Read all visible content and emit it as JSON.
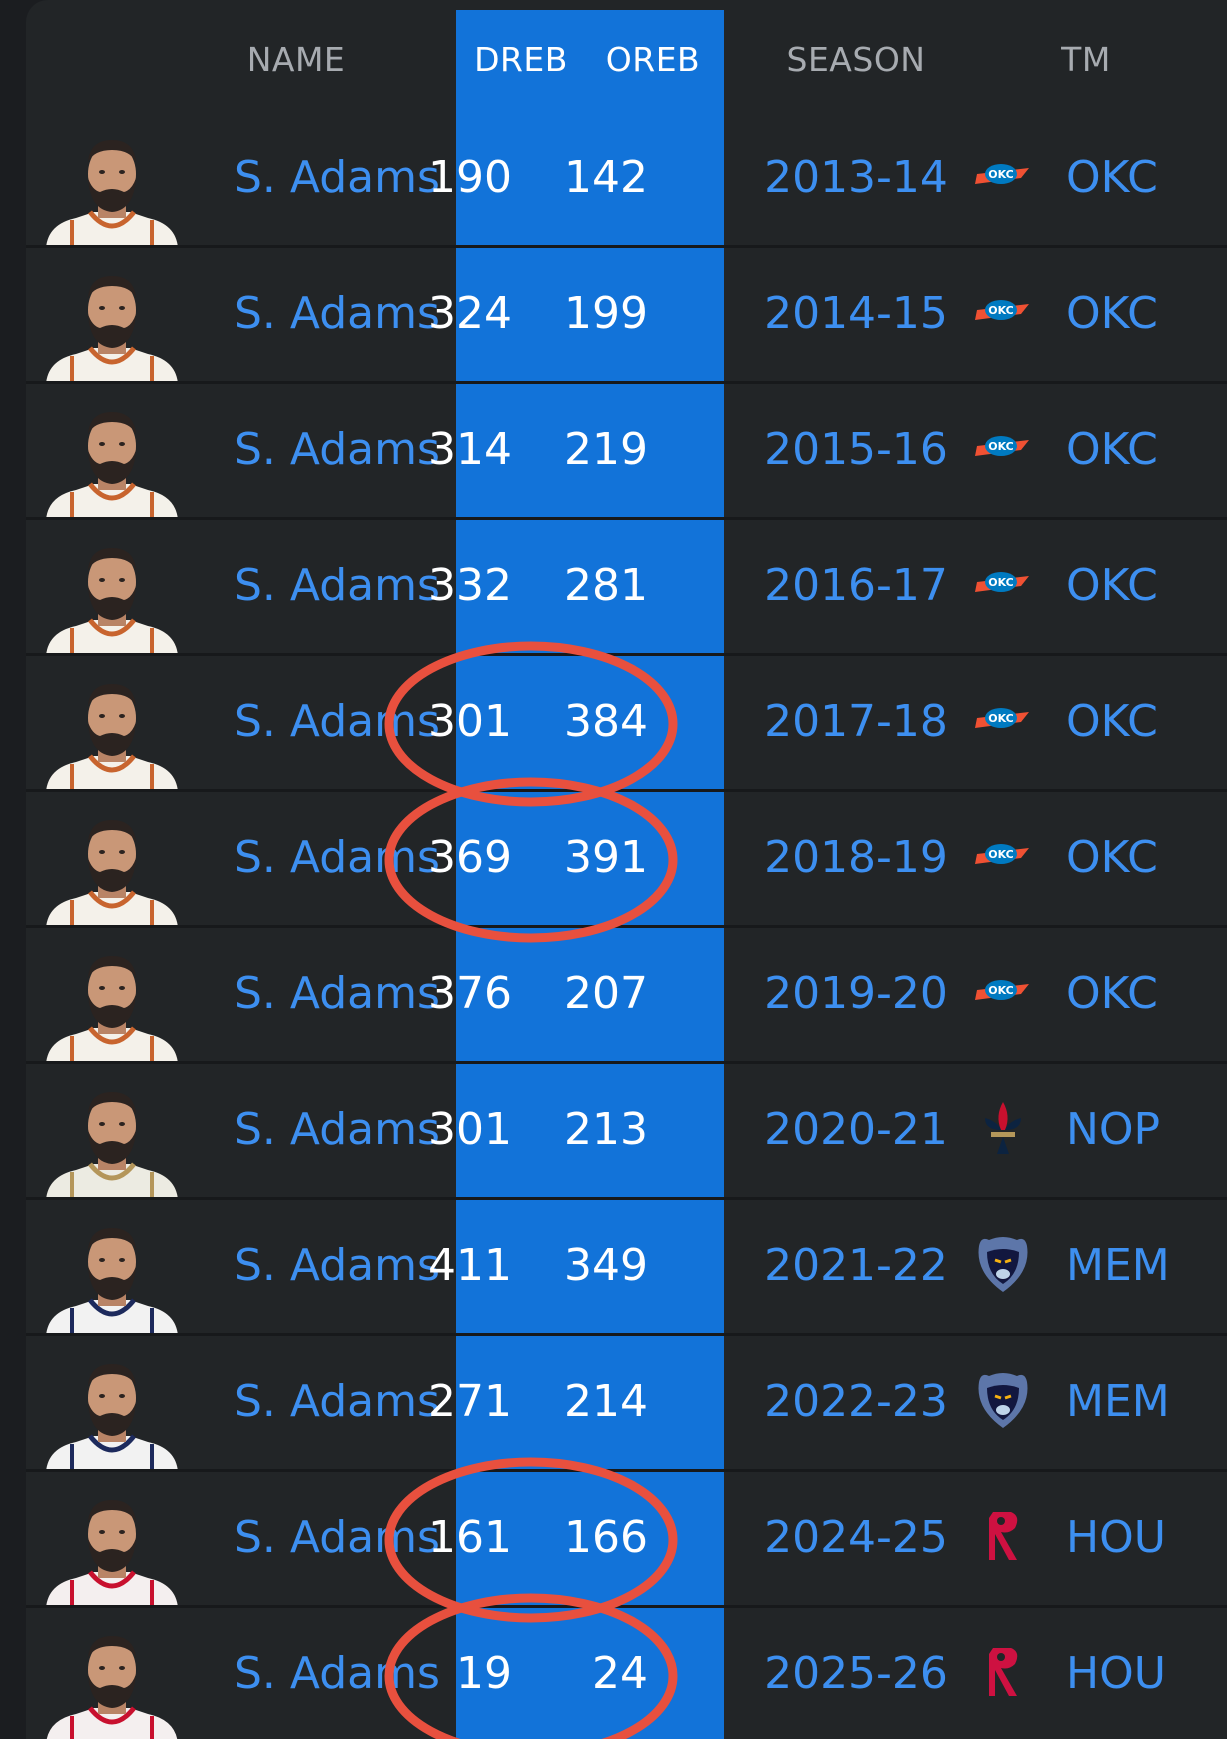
{
  "header": {
    "name": "NAME",
    "dreb": "DREB",
    "oreb": "OREB",
    "season": "SEASON",
    "team": "TM"
  },
  "colors": {
    "highlight_column": "#1273d9",
    "link_text": "#3d8ff0",
    "annotation_circle": "#e8503e",
    "background": "#222527"
  },
  "rows": [
    {
      "name": "S. Adams",
      "dreb": "190",
      "oreb": "142",
      "season": "2013-14",
      "team": "OKC",
      "logo": "okc-thunder-icon",
      "jersey": "okc",
      "circled": false
    },
    {
      "name": "S. Adams",
      "dreb": "324",
      "oreb": "199",
      "season": "2014-15",
      "team": "OKC",
      "logo": "okc-thunder-icon",
      "jersey": "okc",
      "circled": false
    },
    {
      "name": "S. Adams",
      "dreb": "314",
      "oreb": "219",
      "season": "2015-16",
      "team": "OKC",
      "logo": "okc-thunder-icon",
      "jersey": "okc",
      "circled": false
    },
    {
      "name": "S. Adams",
      "dreb": "332",
      "oreb": "281",
      "season": "2016-17",
      "team": "OKC",
      "logo": "okc-thunder-icon",
      "jersey": "okc",
      "circled": false
    },
    {
      "name": "S. Adams",
      "dreb": "301",
      "oreb": "384",
      "season": "2017-18",
      "team": "OKC",
      "logo": "okc-thunder-icon",
      "jersey": "okc",
      "circled": true
    },
    {
      "name": "S. Adams",
      "dreb": "369",
      "oreb": "391",
      "season": "2018-19",
      "team": "OKC",
      "logo": "okc-thunder-icon",
      "jersey": "okc",
      "circled": true
    },
    {
      "name": "S. Adams",
      "dreb": "376",
      "oreb": "207",
      "season": "2019-20",
      "team": "OKC",
      "logo": "okc-thunder-icon",
      "jersey": "okc",
      "circled": false
    },
    {
      "name": "S. Adams",
      "dreb": "301",
      "oreb": "213",
      "season": "2020-21",
      "team": "NOP",
      "logo": "pelicans-fleur-de-lis-icon",
      "jersey": "nop",
      "circled": false
    },
    {
      "name": "S. Adams",
      "dreb": "411",
      "oreb": "349",
      "season": "2021-22",
      "team": "MEM",
      "logo": "grizzlies-bear-icon",
      "jersey": "mem",
      "circled": false
    },
    {
      "name": "S. Adams",
      "dreb": "271",
      "oreb": "214",
      "season": "2022-23",
      "team": "MEM",
      "logo": "grizzlies-bear-icon",
      "jersey": "mem",
      "circled": false
    },
    {
      "name": "S. Adams",
      "dreb": "161",
      "oreb": "166",
      "season": "2024-25",
      "team": "HOU",
      "logo": "rockets-r-icon",
      "jersey": "hou",
      "circled": true
    },
    {
      "name": "S. Adams",
      "dreb": "19",
      "oreb": "24",
      "season": "2025-26",
      "team": "HOU",
      "logo": "rockets-r-icon",
      "jersey": "hou",
      "circled": true
    }
  ]
}
